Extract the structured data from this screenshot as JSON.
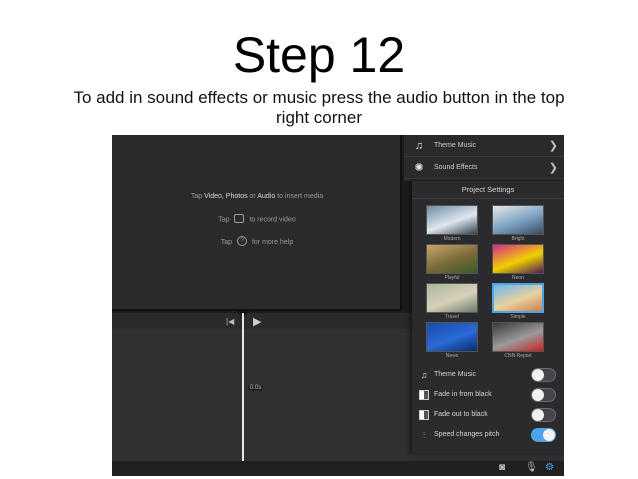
{
  "slide": {
    "title": "Step 12",
    "subtitle": "To add in sound effects or music press the audio button in the top right corner"
  },
  "viewer": {
    "hint1_a": "Tap ",
    "hint1_b": "Video, Photos",
    "hint1_c": " or ",
    "hint1_d": "Audio",
    "hint1_e": " to insert media",
    "hint2_a": "Tap",
    "hint2_b": "to record video",
    "hint3_a": "Tap",
    "hint3_b": "for more help"
  },
  "media_list": {
    "items": [
      {
        "label": "Theme Music",
        "icon": "music-note-icon"
      },
      {
        "label": "Sound Effects",
        "icon": "sound-effects-icon"
      }
    ]
  },
  "project_settings": {
    "title": "Project Settings",
    "themes": [
      {
        "name": "Modern",
        "colors": [
          "#6c8aa8",
          "#dfe6ee",
          "#2f4050"
        ],
        "selected": false
      },
      {
        "name": "Bright",
        "colors": [
          "#e8e8e8",
          "#7aa0c0",
          "#3a4a5a"
        ],
        "selected": false
      },
      {
        "name": "Playful",
        "colors": [
          "#c9a36a",
          "#7a6a3a",
          "#3a5a2a"
        ],
        "selected": false
      },
      {
        "name": "Neon",
        "colors": [
          "#d62a8a",
          "#f0d000",
          "#4a1a5a"
        ],
        "selected": false
      },
      {
        "name": "Travel",
        "colors": [
          "#a8b8a0",
          "#d8d0b8",
          "#6a7a6a"
        ],
        "selected": false
      },
      {
        "name": "Simple",
        "colors": [
          "#6bb8e8",
          "#e8d0a0",
          "#c88050"
        ],
        "selected": true
      },
      {
        "name": "News",
        "colors": [
          "#1a4aa8",
          "#2a6ad8",
          "#0a2a6a"
        ],
        "selected": false
      },
      {
        "name": "CNN Report",
        "colors": [
          "#3a3a3a",
          "#9a9a9a",
          "#c82020"
        ],
        "selected": false
      }
    ],
    "toggles": [
      {
        "label": "Theme Music",
        "icon": "music-note-icon",
        "on": false
      },
      {
        "label": "Fade in from black",
        "icon": "fade-in-icon",
        "on": false
      },
      {
        "label": "Fade out to black",
        "icon": "fade-out-icon",
        "on": false
      },
      {
        "label": "Speed changes pitch",
        "icon": "waveform-icon",
        "on": true
      }
    ]
  },
  "timeline": {
    "time": "0.0s"
  },
  "toolbar": {
    "icons": [
      "camera-icon",
      "microphone-icon",
      "settings-gear-icon"
    ]
  },
  "colors": {
    "accent": "#4fa3e6",
    "background": "#1c1c1e"
  }
}
